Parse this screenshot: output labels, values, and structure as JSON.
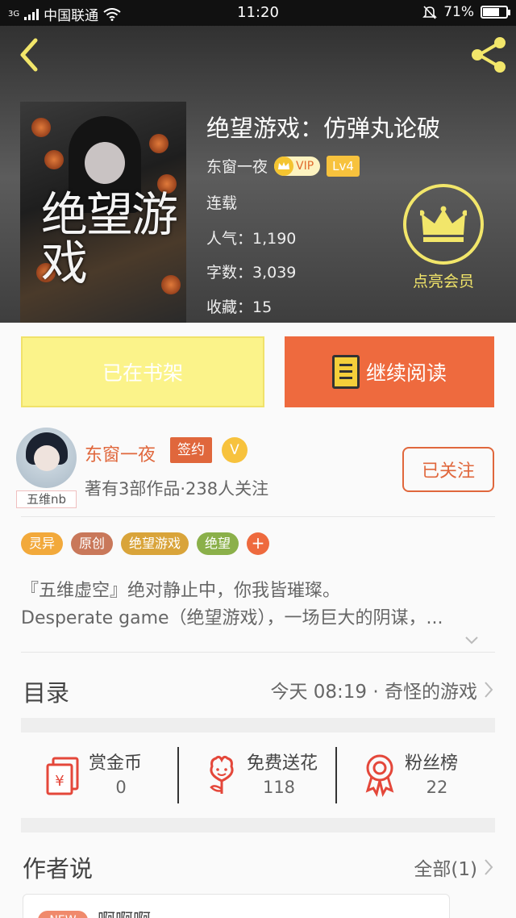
{
  "status_bar": {
    "carrier": "中国联通",
    "network": "3G",
    "time": "11:20",
    "battery": "71%",
    "battery_level": 0.71
  },
  "header": {
    "back_icon": "chevron-left-icon",
    "share_icon": "share-icon"
  },
  "book": {
    "cover_text": "绝望游戏",
    "title": "绝望游戏：仿弹丸论破",
    "author": "东窗一夜",
    "vip_label": "VIP",
    "level": "Lv4",
    "status": "连载",
    "popularity": "人气：1,190",
    "word_count": "字数：3,039",
    "favorites": "收藏：15"
  },
  "member": {
    "label": "点亮会员",
    "icon": "crown-icon"
  },
  "actions": {
    "shelf_label": "已在书架",
    "read_label": "继续阅读"
  },
  "author_card": {
    "name": "东窗一夜",
    "sign_label": "签约",
    "v_label": "V",
    "avatar_tag": "五维nb",
    "stats": "著有3部作品·238人关注",
    "follow_label": "已关注"
  },
  "tags": [
    {
      "label": "灵异",
      "color": "#f2a93b"
    },
    {
      "label": "原创",
      "color": "#c9785a"
    },
    {
      "label": "绝望游戏",
      "color": "#d9a43a"
    },
    {
      "label": "绝望",
      "color": "#8bb04a"
    },
    {
      "label": "+",
      "color": "#ee6a3e"
    }
  ],
  "description": {
    "line1": "『五维虚空』绝对静止中，你我皆璀璨。",
    "line2": "Desperate game（绝望游戏），一场巨大的阴谋，..."
  },
  "catalog": {
    "title": "目录",
    "latest": "今天 08:19 · 奇怪的游戏"
  },
  "stats": [
    {
      "label": "赏金币",
      "value": "0",
      "icon": "red-envelope-icon"
    },
    {
      "label": "免费送花",
      "value": "118",
      "icon": "flower-icon"
    },
    {
      "label": "粉丝榜",
      "value": "22",
      "icon": "rosette-icon"
    }
  ],
  "author_says": {
    "title": "作者说",
    "all_label": "全部(1)",
    "post_badge": "NEW",
    "post_title": "啊啊啊"
  },
  "colors": {
    "accent": "#ee6a3e",
    "member_gold": "#f2e66a",
    "shelf_yellow": "#fbf38a"
  }
}
